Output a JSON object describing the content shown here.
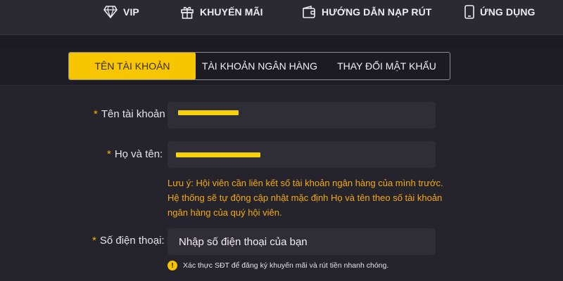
{
  "nav": {
    "items": [
      {
        "label": "VIP",
        "icon": "diamond-icon"
      },
      {
        "label": "KHUYẾN MÃI",
        "icon": "gift-icon"
      },
      {
        "label": "HƯỚNG DẪN NẠP RÚT",
        "icon": "wallet-icon"
      },
      {
        "label": "ỨNG DỤNG",
        "icon": "mobile-phone-icon"
      }
    ]
  },
  "tabs": [
    {
      "label": "TÊN TÀI KHOẢN",
      "active": true
    },
    {
      "label": "TÀI KHOẢN NGÂN HÀNG",
      "active": false
    },
    {
      "label": "THAY ĐỔI MẬT KHẨU",
      "active": false
    }
  ],
  "form": {
    "required_mark": "*",
    "username": {
      "label": "Tên tài khoản"
    },
    "fullname": {
      "label": "Họ và tên:"
    },
    "note": "Lưu ý: Hội viên cần liên kết số tài khoản ngân hàng của mình trước. Hệ thống sẽ tự động cập nhật mặc định Họ và tên theo số tài khoản ngân hàng của quý hội viên.",
    "phone": {
      "label": "Số điện thoại:",
      "placeholder": "Nhập số điện thoại của bạn",
      "hint": "Xác thực SĐT để đăng ký khuyến mãi và rút tiền nhanh chóng.",
      "hint_icon": "!"
    }
  },
  "colors": {
    "accent": "#f8c600",
    "note_text": "#f4aa12",
    "background": "#1d1b22",
    "field_bg": "#2f2d35"
  }
}
